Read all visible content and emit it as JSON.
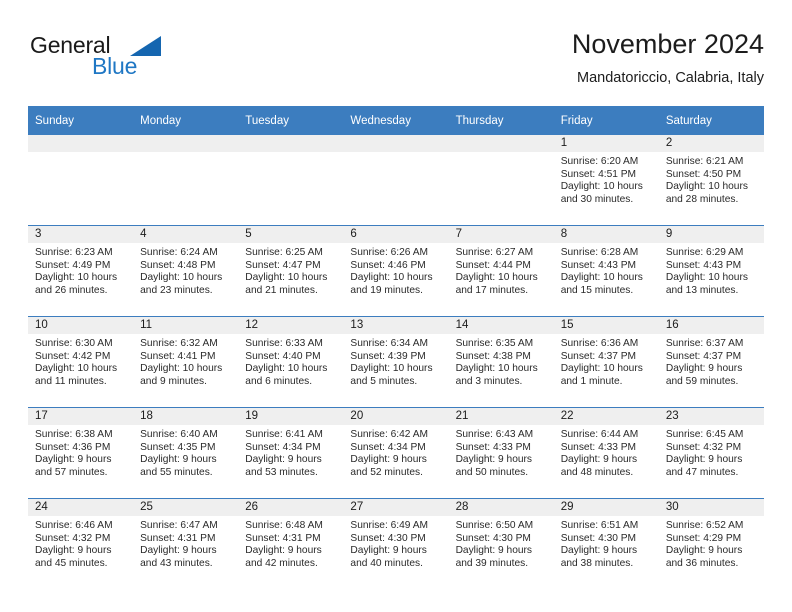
{
  "brand": {
    "name_part1": "General",
    "name_part2": "Blue",
    "triangle_color": "#1566b0",
    "blue_color": "#1f77c4"
  },
  "header": {
    "title": "November 2024",
    "subtitle": "Mandatoriccio, Calabria, Italy"
  },
  "theme": {
    "header_blue": "#3c7dbf",
    "daynum_bg": "#efefef"
  },
  "weekdays": [
    "Sunday",
    "Monday",
    "Tuesday",
    "Wednesday",
    "Thursday",
    "Friday",
    "Saturday"
  ],
  "calendar_data": {
    "type": "table",
    "title": "November 2024",
    "location": "Mandatoriccio, Calabria, Italy",
    "weeks": [
      [
        {
          "day": ""
        },
        {
          "day": ""
        },
        {
          "day": ""
        },
        {
          "day": ""
        },
        {
          "day": ""
        },
        {
          "day": "1",
          "sunrise": "Sunrise: 6:20 AM",
          "sunset": "Sunset: 4:51 PM",
          "daylight1": "Daylight: 10 hours",
          "daylight2": "and 30 minutes."
        },
        {
          "day": "2",
          "sunrise": "Sunrise: 6:21 AM",
          "sunset": "Sunset: 4:50 PM",
          "daylight1": "Daylight: 10 hours",
          "daylight2": "and 28 minutes."
        }
      ],
      [
        {
          "day": "3",
          "sunrise": "Sunrise: 6:23 AM",
          "sunset": "Sunset: 4:49 PM",
          "daylight1": "Daylight: 10 hours",
          "daylight2": "and 26 minutes."
        },
        {
          "day": "4",
          "sunrise": "Sunrise: 6:24 AM",
          "sunset": "Sunset: 4:48 PM",
          "daylight1": "Daylight: 10 hours",
          "daylight2": "and 23 minutes."
        },
        {
          "day": "5",
          "sunrise": "Sunrise: 6:25 AM",
          "sunset": "Sunset: 4:47 PM",
          "daylight1": "Daylight: 10 hours",
          "daylight2": "and 21 minutes."
        },
        {
          "day": "6",
          "sunrise": "Sunrise: 6:26 AM",
          "sunset": "Sunset: 4:46 PM",
          "daylight1": "Daylight: 10 hours",
          "daylight2": "and 19 minutes."
        },
        {
          "day": "7",
          "sunrise": "Sunrise: 6:27 AM",
          "sunset": "Sunset: 4:44 PM",
          "daylight1": "Daylight: 10 hours",
          "daylight2": "and 17 minutes."
        },
        {
          "day": "8",
          "sunrise": "Sunrise: 6:28 AM",
          "sunset": "Sunset: 4:43 PM",
          "daylight1": "Daylight: 10 hours",
          "daylight2": "and 15 minutes."
        },
        {
          "day": "9",
          "sunrise": "Sunrise: 6:29 AM",
          "sunset": "Sunset: 4:43 PM",
          "daylight1": "Daylight: 10 hours",
          "daylight2": "and 13 minutes."
        }
      ],
      [
        {
          "day": "10",
          "sunrise": "Sunrise: 6:30 AM",
          "sunset": "Sunset: 4:42 PM",
          "daylight1": "Daylight: 10 hours",
          "daylight2": "and 11 minutes."
        },
        {
          "day": "11",
          "sunrise": "Sunrise: 6:32 AM",
          "sunset": "Sunset: 4:41 PM",
          "daylight1": "Daylight: 10 hours",
          "daylight2": "and 9 minutes."
        },
        {
          "day": "12",
          "sunrise": "Sunrise: 6:33 AM",
          "sunset": "Sunset: 4:40 PM",
          "daylight1": "Daylight: 10 hours",
          "daylight2": "and 6 minutes."
        },
        {
          "day": "13",
          "sunrise": "Sunrise: 6:34 AM",
          "sunset": "Sunset: 4:39 PM",
          "daylight1": "Daylight: 10 hours",
          "daylight2": "and 5 minutes."
        },
        {
          "day": "14",
          "sunrise": "Sunrise: 6:35 AM",
          "sunset": "Sunset: 4:38 PM",
          "daylight1": "Daylight: 10 hours",
          "daylight2": "and 3 minutes."
        },
        {
          "day": "15",
          "sunrise": "Sunrise: 6:36 AM",
          "sunset": "Sunset: 4:37 PM",
          "daylight1": "Daylight: 10 hours",
          "daylight2": "and 1 minute."
        },
        {
          "day": "16",
          "sunrise": "Sunrise: 6:37 AM",
          "sunset": "Sunset: 4:37 PM",
          "daylight1": "Daylight: 9 hours",
          "daylight2": "and 59 minutes."
        }
      ],
      [
        {
          "day": "17",
          "sunrise": "Sunrise: 6:38 AM",
          "sunset": "Sunset: 4:36 PM",
          "daylight1": "Daylight: 9 hours",
          "daylight2": "and 57 minutes."
        },
        {
          "day": "18",
          "sunrise": "Sunrise: 6:40 AM",
          "sunset": "Sunset: 4:35 PM",
          "daylight1": "Daylight: 9 hours",
          "daylight2": "and 55 minutes."
        },
        {
          "day": "19",
          "sunrise": "Sunrise: 6:41 AM",
          "sunset": "Sunset: 4:34 PM",
          "daylight1": "Daylight: 9 hours",
          "daylight2": "and 53 minutes."
        },
        {
          "day": "20",
          "sunrise": "Sunrise: 6:42 AM",
          "sunset": "Sunset: 4:34 PM",
          "daylight1": "Daylight: 9 hours",
          "daylight2": "and 52 minutes."
        },
        {
          "day": "21",
          "sunrise": "Sunrise: 6:43 AM",
          "sunset": "Sunset: 4:33 PM",
          "daylight1": "Daylight: 9 hours",
          "daylight2": "and 50 minutes."
        },
        {
          "day": "22",
          "sunrise": "Sunrise: 6:44 AM",
          "sunset": "Sunset: 4:33 PM",
          "daylight1": "Daylight: 9 hours",
          "daylight2": "and 48 minutes."
        },
        {
          "day": "23",
          "sunrise": "Sunrise: 6:45 AM",
          "sunset": "Sunset: 4:32 PM",
          "daylight1": "Daylight: 9 hours",
          "daylight2": "and 47 minutes."
        }
      ],
      [
        {
          "day": "24",
          "sunrise": "Sunrise: 6:46 AM",
          "sunset": "Sunset: 4:32 PM",
          "daylight1": "Daylight: 9 hours",
          "daylight2": "and 45 minutes."
        },
        {
          "day": "25",
          "sunrise": "Sunrise: 6:47 AM",
          "sunset": "Sunset: 4:31 PM",
          "daylight1": "Daylight: 9 hours",
          "daylight2": "and 43 minutes."
        },
        {
          "day": "26",
          "sunrise": "Sunrise: 6:48 AM",
          "sunset": "Sunset: 4:31 PM",
          "daylight1": "Daylight: 9 hours",
          "daylight2": "and 42 minutes."
        },
        {
          "day": "27",
          "sunrise": "Sunrise: 6:49 AM",
          "sunset": "Sunset: 4:30 PM",
          "daylight1": "Daylight: 9 hours",
          "daylight2": "and 40 minutes."
        },
        {
          "day": "28",
          "sunrise": "Sunrise: 6:50 AM",
          "sunset": "Sunset: 4:30 PM",
          "daylight1": "Daylight: 9 hours",
          "daylight2": "and 39 minutes."
        },
        {
          "day": "29",
          "sunrise": "Sunrise: 6:51 AM",
          "sunset": "Sunset: 4:30 PM",
          "daylight1": "Daylight: 9 hours",
          "daylight2": "and 38 minutes."
        },
        {
          "day": "30",
          "sunrise": "Sunrise: 6:52 AM",
          "sunset": "Sunset: 4:29 PM",
          "daylight1": "Daylight: 9 hours",
          "daylight2": "and 36 minutes."
        }
      ]
    ]
  }
}
